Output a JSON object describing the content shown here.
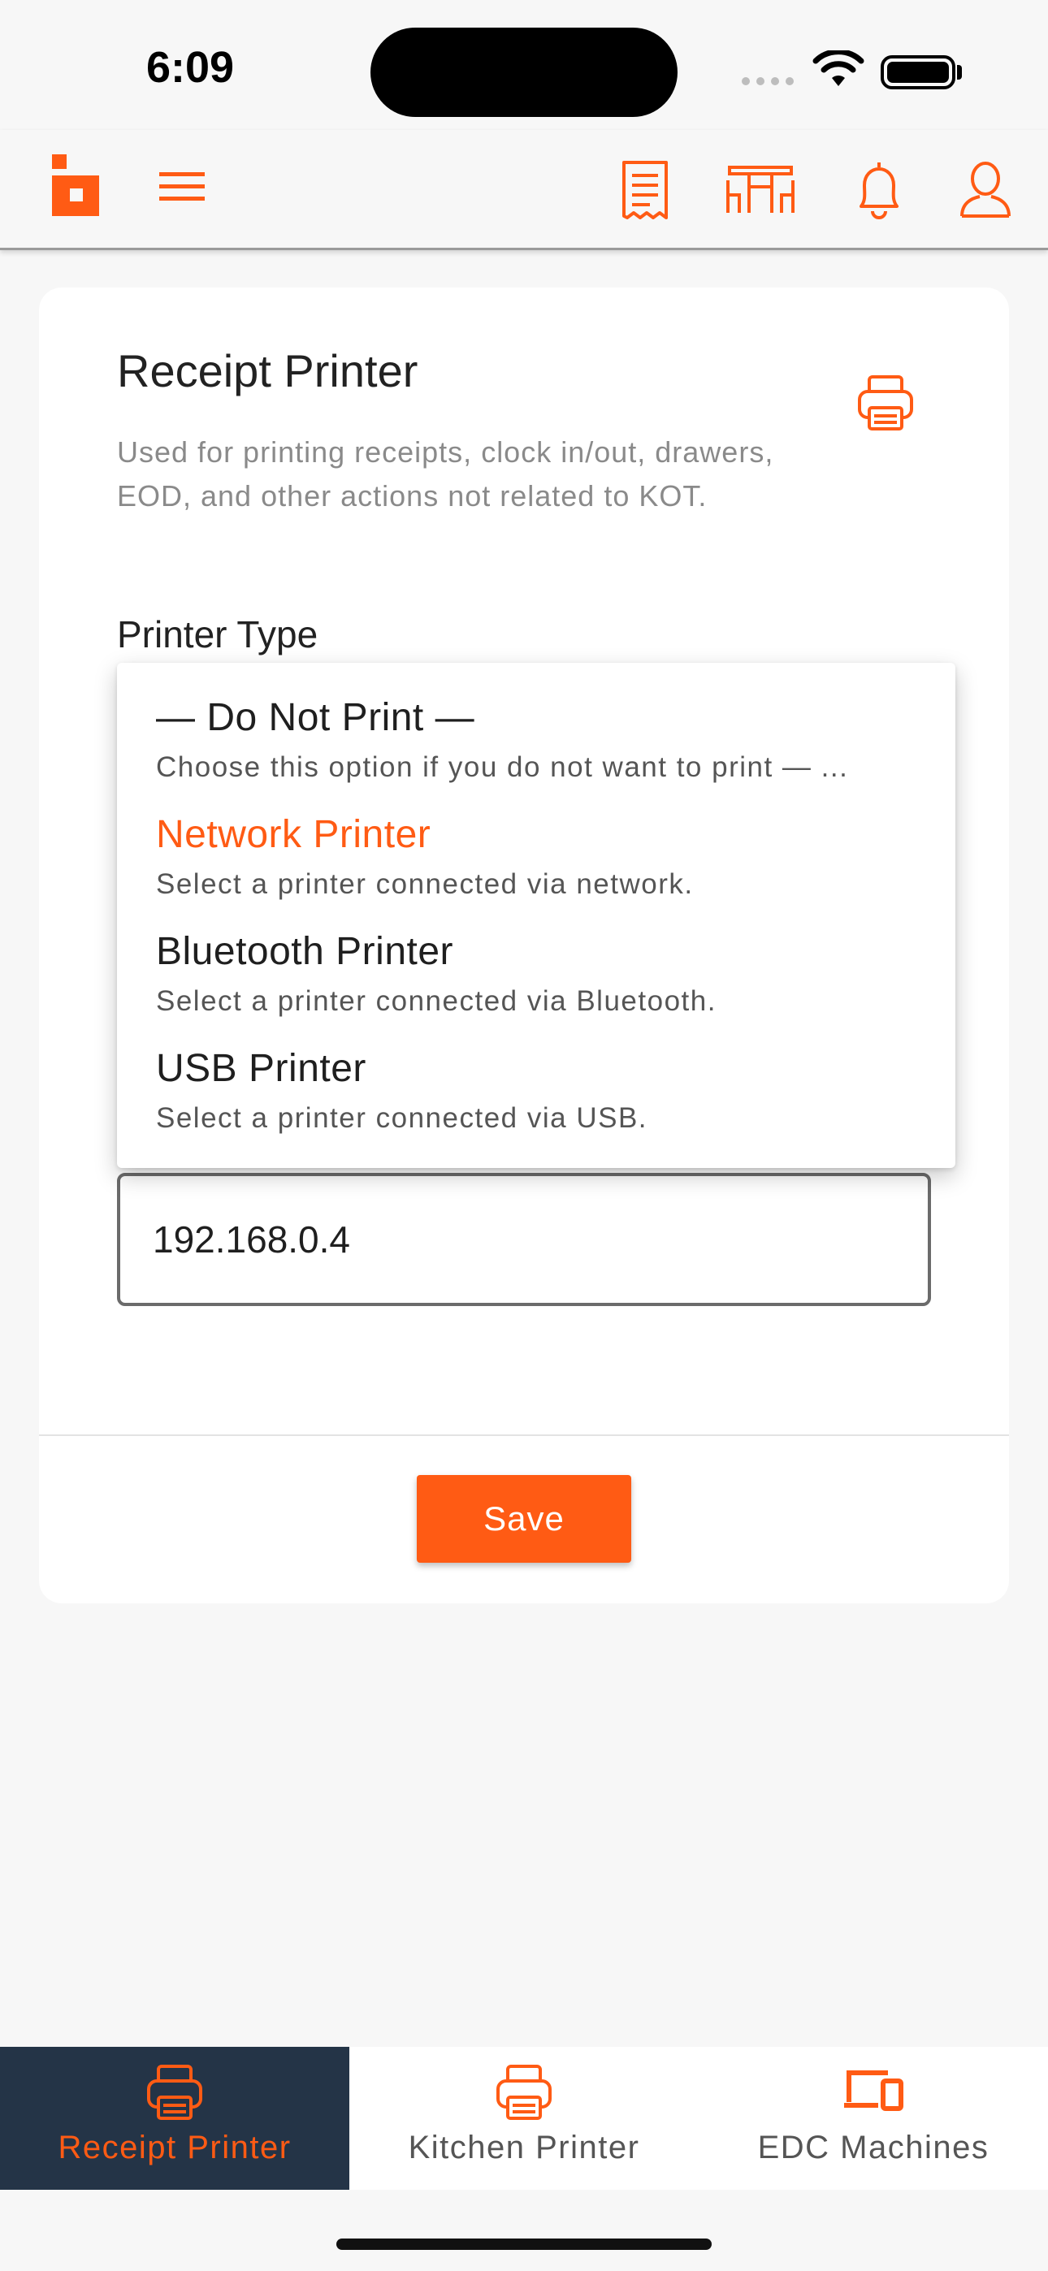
{
  "status_bar": {
    "time": "6:09"
  },
  "header": {
    "icons": [
      "logo-icon",
      "menu-icon",
      "receipt-icon",
      "tables-icon",
      "bell-icon",
      "user-icon"
    ]
  },
  "card": {
    "title": "Receipt Printer",
    "description": "Used for printing receipts, clock in/out, drawers, EOD, and other actions not related to KOT.",
    "printer_type_label": "Printer Type",
    "ip_value": "192.168.0.4",
    "save_label": "Save"
  },
  "dropdown": {
    "options": [
      {
        "title": "— Do Not Print —",
        "subtitle": "Choose this option if you do not want to print — ..."
      },
      {
        "title": "Network Printer",
        "subtitle": "Select a printer connected via network."
      },
      {
        "title": "Bluetooth Printer",
        "subtitle": "Select a printer connected via Bluetooth."
      },
      {
        "title": "USB Printer",
        "subtitle": "Select a printer connected via USB."
      }
    ],
    "selected": "Network Printer"
  },
  "tabs": [
    {
      "label": "Receipt Printer",
      "icon": "printer-icon",
      "active": true
    },
    {
      "label": "Kitchen Printer",
      "icon": "printer-icon",
      "active": false
    },
    {
      "label": "EDC Machines",
      "icon": "devices-icon",
      "active": false
    }
  ],
  "colors": {
    "accent": "#FF5B14",
    "tab_active_bg": "#243447",
    "background": "#F7F7F7"
  }
}
